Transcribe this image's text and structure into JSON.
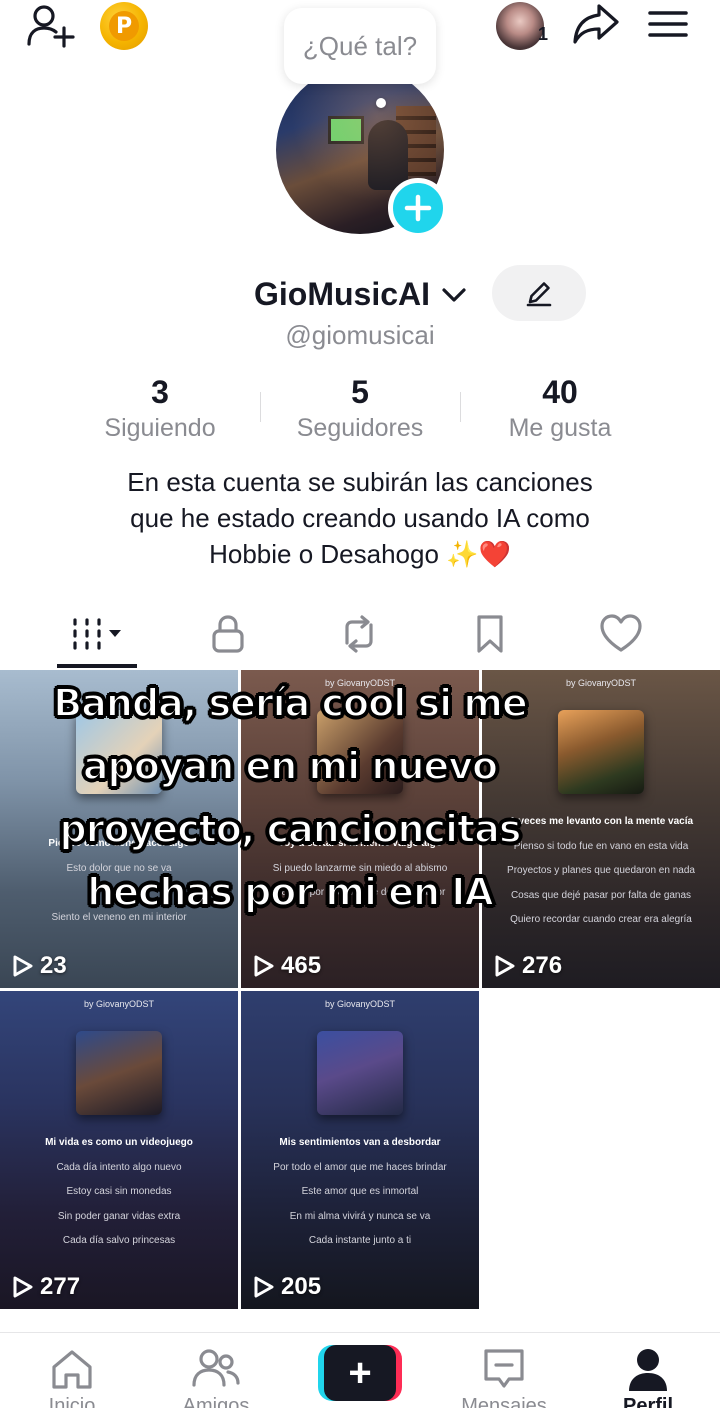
{
  "topbar": {
    "icons": [
      "add-friend-icon",
      "coins-icon",
      "share-icon",
      "menu-icon"
    ],
    "coin_letter": "P",
    "notification_count": "1"
  },
  "bubble": {
    "text": "¿Qué tal?"
  },
  "profile": {
    "display_name": "GioMusicAI",
    "username": "@giomusicai",
    "stats": [
      {
        "value": "3",
        "label": "Siguiendo"
      },
      {
        "value": "5",
        "label": "Seguidores"
      },
      {
        "value": "40",
        "label": "Me gusta"
      }
    ],
    "bio_lines": [
      "En esta cuenta se subirán las canciones",
      "que he estado creando usando IA como",
      "Hobbie o Desahogo ✨❤️"
    ]
  },
  "tabs": [
    "videos",
    "private",
    "reposts",
    "favorites",
    "liked"
  ],
  "caption_lines": [
    "Banda, sería cool si me",
    "apoyan en mi nuevo",
    "proyecto, cancioncitas",
    "hechas por mi en IA"
  ],
  "videos": [
    {
      "views": "23",
      "credit": "by GiovanyODST",
      "lines": [
        "Pienso cómo tiene hacer algo",
        "Esto dolor que no se va",
        "Me",
        "Siento el veneno en mi interior"
      ],
      "bg": [
        "#8aa0b8",
        "#3a4a5a"
      ]
    },
    {
      "views": "465",
      "credit": "by GiovanyODST",
      "lines": [
        "Voy a cortar si la mente valgo algo",
        "Si puedo lanzarme sin miedo al abismo",
        "Perdón por el caos que dejo otro amor"
      ],
      "bg": [
        "#6a4d46",
        "#2b2024"
      ]
    },
    {
      "views": "276",
      "credit": "by GiovanyODST",
      "lines": [
        "A veces me levanto con la mente vacía",
        "Pienso si todo fue en vano en esta vida",
        "Proyectos y planes que quedaron en nada",
        "Cosas que dejé pasar por falta de ganas",
        "Quiero recordar cuando crear era alegría"
      ],
      "bg": [
        "#5a4a3e",
        "#1e1c22"
      ]
    },
    {
      "views": "277",
      "credit": "by GiovanyODST",
      "lines": [
        "Mi vida es como un videojuego",
        "Cada día intento algo nuevo",
        "Estoy casi sin monedas",
        "Sin poder ganar vidas extra",
        "Cada día salvo princesas"
      ],
      "bg": [
        "#2e3a66",
        "#1a1624"
      ]
    },
    {
      "views": "205",
      "credit": "by GiovanyODST",
      "lines": [
        "Mis sentimientos van a desbordar",
        "Por todo el amor que me haces brindar",
        "Este amor que es inmortal",
        "En mi alma vivirá y nunca se va",
        "Cada instante junto a ti"
      ],
      "bg": [
        "#2a3760",
        "#14161e"
      ]
    }
  ],
  "bottom_nav": [
    {
      "label": "Inicio",
      "icon": "home-icon"
    },
    {
      "label": "Amigos",
      "icon": "friends-icon"
    },
    {
      "label": "",
      "icon": "create-icon"
    },
    {
      "label": "Mensajes",
      "icon": "inbox-icon"
    },
    {
      "label": "Perfil",
      "icon": "profile-icon"
    }
  ],
  "colors": {
    "accent_cyan": "#20d5ec",
    "accent_red": "#fe2c55",
    "text_primary": "#161823",
    "text_secondary": "#8a8b91"
  }
}
